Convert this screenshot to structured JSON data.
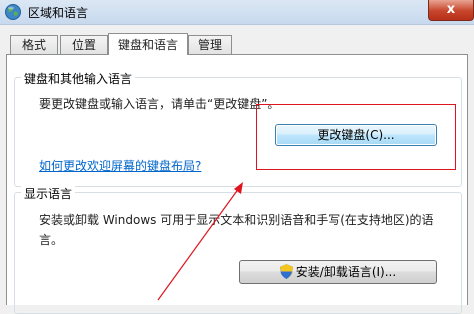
{
  "window": {
    "title": "区域和语言",
    "close_label": "x"
  },
  "tabs": [
    {
      "label": "格式"
    },
    {
      "label": "位置"
    },
    {
      "label": "键盘和语言",
      "active": true
    },
    {
      "label": "管理"
    }
  ],
  "keyboard_group": {
    "title": "键盘和其他输入语言",
    "description": "要更改键盘或输入语言，请单击“更改键盘”。",
    "change_button": "更改键盘(C)...",
    "help_link": "如何更改欢迎屏幕的键盘布局?"
  },
  "display_group": {
    "title": "显示语言",
    "description_line1": "安装或卸载 Windows 可用于显示文本和识别语音和手写(在支持地区)的语",
    "description_line2": "言。",
    "install_button": "安装/卸载语言(I)..."
  },
  "colors": {
    "annotation_red": "#e0141e",
    "link_blue": "#0066cc"
  },
  "icons": [
    "globe-icon",
    "shield-icon",
    "close-icon"
  ]
}
